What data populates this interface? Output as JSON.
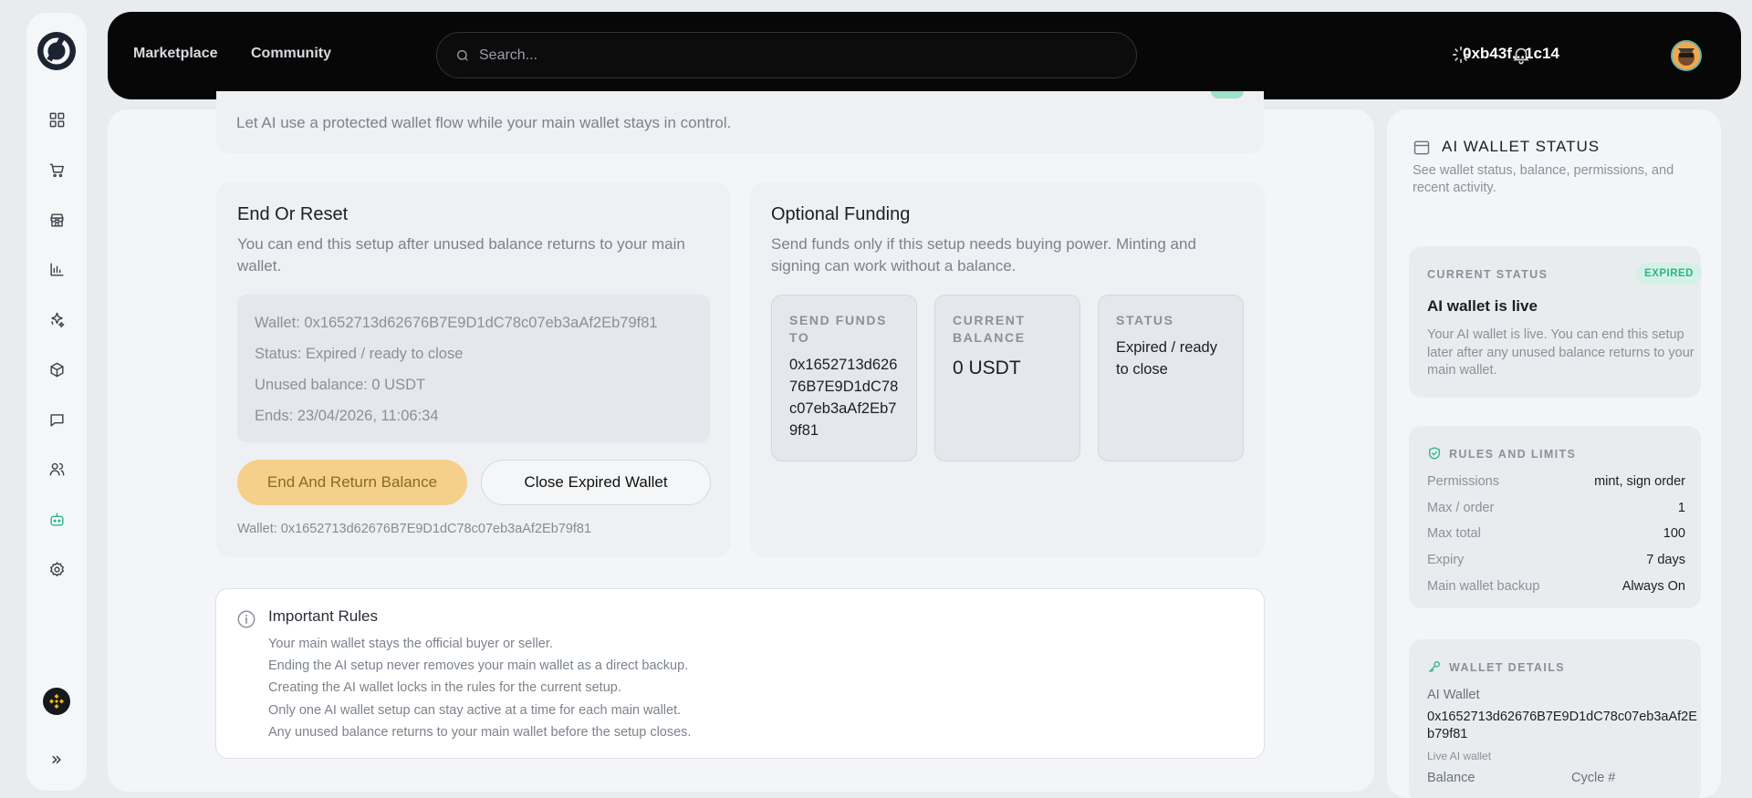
{
  "nav": {
    "marketplace": "Marketplace",
    "community": "Community",
    "search_placeholder": "Search...",
    "address": "0xb43f...1c14"
  },
  "sidebar": {
    "items": [
      "dashboard-icon",
      "cart-icon",
      "store-icon",
      "chart-icon",
      "sparkle-icon",
      "cube-icon",
      "chat-icon",
      "users-icon",
      "bot-icon",
      "gear-icon"
    ],
    "active": "bot-icon",
    "expand_glyph": "»"
  },
  "top_card": {
    "text": "Let AI use a protected wallet flow while your main wallet stays in control."
  },
  "end_reset": {
    "title": "End Or Reset",
    "desc": "You can end this setup after unused balance returns to your main wallet.",
    "wallet": "Wallet: 0x1652713d62676B7E9D1dC78c07eb3aAf2Eb79f81",
    "status": "Status: Expired / ready to close",
    "unused": "Unused balance: 0 USDT",
    "ends": "Ends: 23/04/2026, 11:06:34",
    "btn_end": "End And Return Balance",
    "btn_close": "Close Expired Wallet",
    "footer": "Wallet: 0x1652713d62676B7E9D1dC78c07eb3aAf2Eb79f81"
  },
  "funding": {
    "title": "Optional Funding",
    "desc": "Send funds only if this setup needs buying power. Minting and signing can work without a balance.",
    "send_label": "SEND FUNDS TO",
    "send_value": "0x1652713d62676B7E9D1dC78c07eb3aAf2Eb79f81",
    "balance_label": "CURRENT BALANCE",
    "balance_value": "0 USDT",
    "status_label": "STATUS",
    "status_value": "Expired / ready to close"
  },
  "rules": {
    "title": "Important Rules",
    "items": [
      "Your main wallet stays the official buyer or seller.",
      "Ending the AI setup never removes your main wallet as a direct backup.",
      "Creating the AI wallet locks in the rules for the current setup.",
      "Only one AI wallet setup can stay active at a time for each main wallet.",
      "Any unused balance returns to your main wallet before the setup closes."
    ]
  },
  "status_panel": {
    "title": "AI WALLET STATUS",
    "desc": "See wallet status, balance, permissions, and recent activity.",
    "current": {
      "label": "CURRENT STATUS",
      "badge": "EXPIRED",
      "headline": "AI wallet is live",
      "body": "Your AI wallet is live. You can end this setup later after any unused balance returns to your main wallet."
    },
    "rules_limits": {
      "label": "RULES AND LIMITS",
      "rows": [
        {
          "k": "Permissions",
          "v": "mint, sign order"
        },
        {
          "k": "Max / order",
          "v": "1"
        },
        {
          "k": "Max total",
          "v": "100"
        },
        {
          "k": "Expiry",
          "v": "7 days"
        },
        {
          "k": "Main wallet backup",
          "v": "Always On"
        }
      ]
    },
    "wallet_details": {
      "label": "WALLET DETAILS",
      "ai_wallet_label": "AI Wallet",
      "ai_wallet_value": "0x1652713d62676B7E9D1dC78c07eb3aAf2Eb79f81",
      "sub": "Live AI wallet",
      "balance_label": "Balance",
      "cycle_label": "Cycle #"
    }
  },
  "colors": {
    "accent": "#2bb58a",
    "primary_button": "#f4d08a",
    "nav_bg": "#070707"
  }
}
